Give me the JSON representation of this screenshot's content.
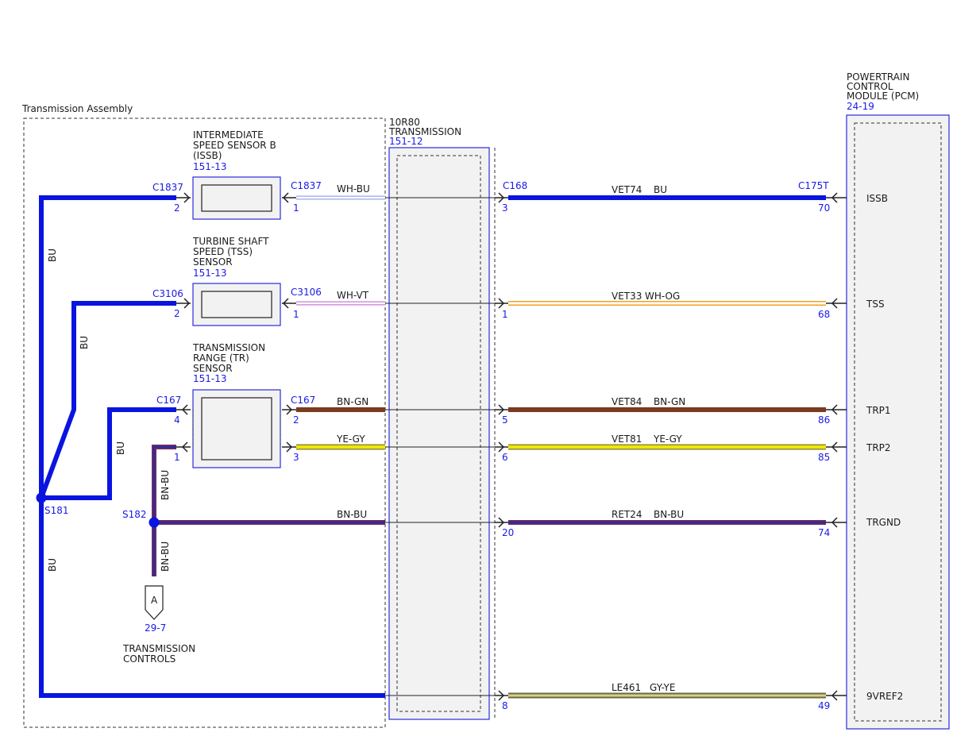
{
  "transmission_assembly": {
    "label": "Transmission Assembly"
  },
  "transmission": {
    "name_line1": "10R80",
    "name_line2": "TRANSMISSION",
    "ref": "151-12"
  },
  "pcm": {
    "line1": "POWERTRAIN",
    "line2": "CONTROL",
    "line3": "MODULE (PCM)",
    "ref": "24-19"
  },
  "sensors": [
    {
      "lines": [
        "INTERMEDIATE",
        "SPEED SENSOR B",
        "(ISSB)"
      ],
      "ref": "151-13"
    },
    {
      "lines": [
        "TURBINE SHAFT",
        "SPEED (TSS)",
        "SENSOR"
      ],
      "ref": "151-13"
    },
    {
      "lines": [
        "TRANSMISSION",
        "RANGE (TR)",
        "SENSOR"
      ],
      "ref": "151-13"
    }
  ],
  "sensor_connectors": [
    {
      "left_conn": "C1837",
      "left_pin": "2",
      "right_conn": "C1837",
      "right_pin": "1"
    },
    {
      "left_conn": "C3106",
      "left_pin": "2",
      "right_conn": "C3106",
      "right_pin": "1"
    },
    {
      "left_conn": "C167",
      "left_pin": "4",
      "right_conn": "C167",
      "right_pin": "2",
      "left_pin2": "1",
      "right_pin2": "3"
    }
  ],
  "inner_wires": [
    "WH-BU",
    "WH-VT",
    "BN-GN",
    "YE-GY",
    "BN-BU"
  ],
  "circuits": [
    {
      "circuit": "VET74",
      "color": "BU",
      "trans_pin": "3",
      "pcm_pin": "70",
      "signal": "ISSB"
    },
    {
      "circuit": "VET33",
      "color": "WH-OG",
      "trans_pin": "1",
      "pcm_pin": "68",
      "signal": "TSS"
    },
    {
      "circuit": "VET84",
      "color": "BN-GN",
      "trans_pin": "5",
      "pcm_pin": "86",
      "signal": "TRP1"
    },
    {
      "circuit": "VET81",
      "color": "YE-GY",
      "trans_pin": "6",
      "pcm_pin": "85",
      "signal": "TRP2"
    },
    {
      "circuit": "RET24",
      "color": "BN-BU",
      "trans_pin": "20",
      "pcm_pin": "74",
      "signal": "TRGND"
    },
    {
      "circuit": "LE461",
      "color": "GY-YE",
      "trans_pin": "8",
      "pcm_pin": "49",
      "signal": "9VREF2"
    }
  ],
  "connectors": {
    "trans_side": "C168",
    "pcm_side": "C175T"
  },
  "splices": {
    "s181": "S181",
    "s182": "S182"
  },
  "harness_labels": {
    "bu": "BU",
    "bn_bu": "BN-BU"
  },
  "offpage": {
    "letter": "A",
    "ref": "29-7",
    "line1": "TRANSMISSION",
    "line2": "CONTROLS"
  },
  "colors": {
    "blue_wire": "#0a14e0",
    "brown": "#7a3b1f",
    "yellow": "#f0e600",
    "white_violet": "#c87ad8",
    "white_orange": "#f0a020",
    "brown_blue": "#6a2a6a",
    "gray_yellow": "#a5a070",
    "ref_blue": "#1a1ae6"
  }
}
